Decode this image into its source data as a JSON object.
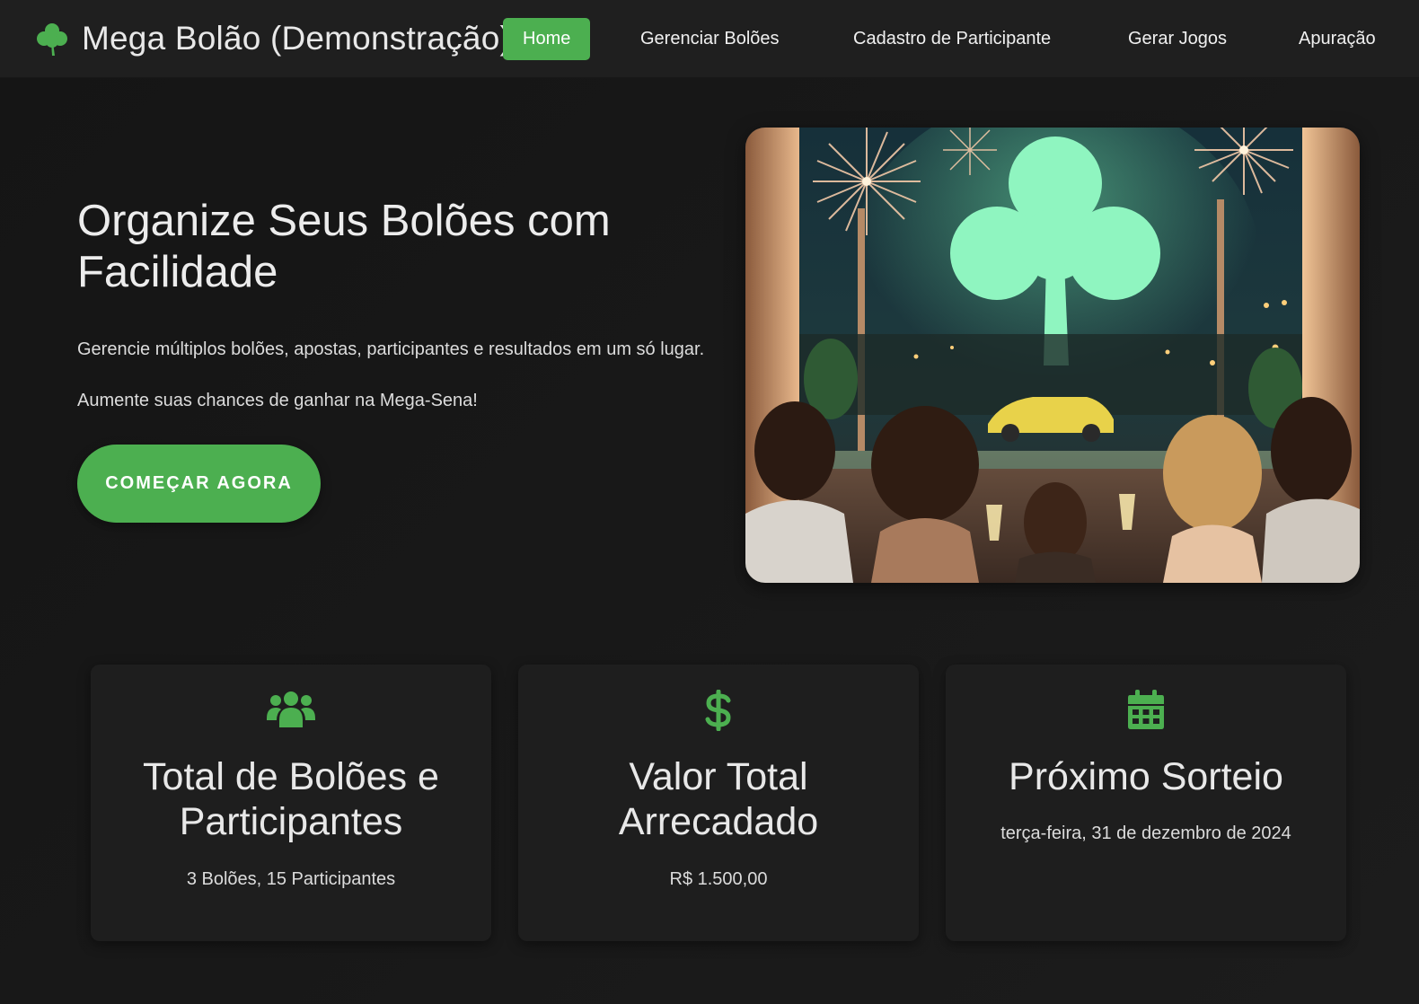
{
  "brand": {
    "icon": "clover-icon",
    "title": "Mega Bolão (Demonstração)"
  },
  "nav": {
    "items": [
      {
        "label": "Home",
        "active": true
      },
      {
        "label": "Gerenciar Bolões",
        "active": false
      },
      {
        "label": "Cadastro de Participante",
        "active": false
      },
      {
        "label": "Gerar Jogos",
        "active": false
      },
      {
        "label": "Apuração",
        "active": false
      }
    ]
  },
  "hero": {
    "title": "Organize Seus Bolões com Facilidade",
    "subtitle": "Gerencie múltiplos bolões, apostas, participantes e resultados em um só lugar. Aumente suas chances de ganhar na Mega-Sena!",
    "cta_label": "COMEÇAR AGORA",
    "image": "celebration-illustration"
  },
  "cards": [
    {
      "icon": "users-icon",
      "title": "Total de Bolões e Participantes",
      "value": "3 Bolões, 15 Participantes"
    },
    {
      "icon": "dollar-icon",
      "title": "Valor Total Arrecadado",
      "value": "R$ 1.500,00"
    },
    {
      "icon": "calendar-icon",
      "title": "Próximo Sorteio",
      "value": "terça-feira, 31 de dezembro de 2024"
    }
  ],
  "colors": {
    "accent": "#4caf50",
    "background": "#141414",
    "navbar": "#1f1f1f",
    "card": "#1e1e1e"
  }
}
